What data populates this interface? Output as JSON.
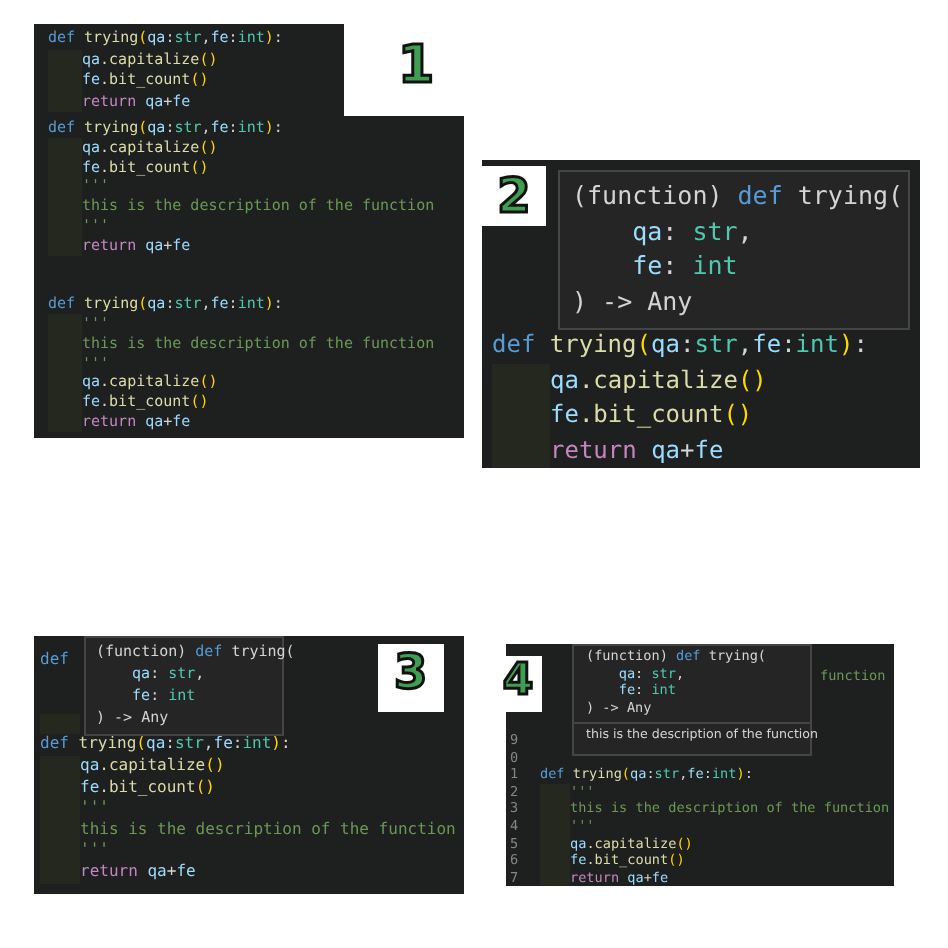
{
  "panels": [
    {
      "number": "1",
      "editors": [
        {
          "lines": [
            {
              "kind": "code",
              "indented": false,
              "tokens": [
                {
                  "kind": "keyword",
                  "text": "def"
                },
                {
                  "kind": "function",
                  "text": "trying",
                  "spaced": true
                },
                {
                  "kind": "bracket",
                  "text": "("
                },
                {
                  "kind": "param",
                  "text": "qa"
                },
                {
                  "kind": "plain",
                  "text": ":"
                },
                {
                  "kind": "type",
                  "text": "str"
                },
                {
                  "kind": "plain",
                  "text": ","
                },
                {
                  "kind": "param",
                  "text": "fe"
                },
                {
                  "kind": "plain",
                  "text": ":"
                },
                {
                  "kind": "type",
                  "text": "int"
                },
                {
                  "kind": "bracket",
                  "text": ")"
                },
                {
                  "kind": "plain",
                  "text": ":"
                }
              ]
            },
            {
              "kind": "code",
              "indented": true,
              "tokens": [
                {
                  "kind": "param",
                  "text": "qa"
                },
                {
                  "kind": "function",
                  "text": ".capitalize"
                },
                {
                  "kind": "bracket",
                  "text": "()"
                }
              ]
            },
            {
              "kind": "code",
              "indented": true,
              "tokens": [
                {
                  "kind": "param",
                  "text": "fe"
                },
                {
                  "kind": "function",
                  "text": ".bit_count"
                },
                {
                  "kind": "bracket",
                  "text": "()"
                }
              ]
            },
            {
              "kind": "code",
              "indented": true,
              "tokens": [
                {
                  "kind": "control",
                  "text": "return"
                },
                {
                  "kind": "param",
                  "text": "qa",
                  "spaced": true
                },
                {
                  "kind": "plain",
                  "text": "+"
                },
                {
                  "kind": "param",
                  "text": "fe"
                }
              ]
            }
          ]
        },
        {
          "lines": [
            {
              "kind": "code",
              "indented": false,
              "tokens": [
                {
                  "kind": "keyword",
                  "text": "def"
                },
                {
                  "kind": "function",
                  "text": "trying",
                  "spaced": true
                },
                {
                  "kind": "bracket",
                  "text": "("
                },
                {
                  "kind": "param",
                  "text": "qa"
                },
                {
                  "kind": "plain",
                  "text": ":"
                },
                {
                  "kind": "type",
                  "text": "str"
                },
                {
                  "kind": "plain",
                  "text": ","
                },
                {
                  "kind": "param",
                  "text": "fe"
                },
                {
                  "kind": "plain",
                  "text": ":"
                },
                {
                  "kind": "type",
                  "text": "int"
                },
                {
                  "kind": "bracket",
                  "text": ")"
                },
                {
                  "kind": "plain",
                  "text": ":"
                }
              ]
            },
            {
              "kind": "code",
              "indented": true,
              "tokens": [
                {
                  "kind": "param",
                  "text": "qa"
                },
                {
                  "kind": "function",
                  "text": ".capitalize"
                },
                {
                  "kind": "bracket",
                  "text": "()"
                }
              ]
            },
            {
              "kind": "code",
              "indented": true,
              "tokens": [
                {
                  "kind": "param",
                  "text": "fe"
                },
                {
                  "kind": "function",
                  "text": ".bit_count"
                },
                {
                  "kind": "bracket",
                  "text": "()"
                }
              ]
            },
            {
              "kind": "code",
              "indented": true,
              "tokens": [
                {
                  "kind": "comment",
                  "text": "'''"
                }
              ]
            },
            {
              "kind": "code",
              "indented": true,
              "tokens": [
                {
                  "kind": "comment",
                  "text": "this is the description of the function"
                }
              ]
            },
            {
              "kind": "code",
              "indented": true,
              "tokens": [
                {
                  "kind": "comment",
                  "text": "'''"
                }
              ]
            },
            {
              "kind": "code",
              "indented": true,
              "tokens": [
                {
                  "kind": "control",
                  "text": "return"
                },
                {
                  "kind": "param",
                  "text": "qa",
                  "spaced": true
                },
                {
                  "kind": "plain",
                  "text": "+"
                },
                {
                  "kind": "param",
                  "text": "fe"
                }
              ]
            },
            {
              "kind": "blank",
              "indented": false
            },
            {
              "kind": "blank",
              "indented": false
            },
            {
              "kind": "code",
              "indented": false,
              "tokens": [
                {
                  "kind": "keyword",
                  "text": "def"
                },
                {
                  "kind": "function",
                  "text": "trying",
                  "spaced": true
                },
                {
                  "kind": "bracket",
                  "text": "("
                },
                {
                  "kind": "param",
                  "text": "qa"
                },
                {
                  "kind": "plain",
                  "text": ":"
                },
                {
                  "kind": "type",
                  "text": "str"
                },
                {
                  "kind": "plain",
                  "text": ","
                },
                {
                  "kind": "param",
                  "text": "fe"
                },
                {
                  "kind": "plain",
                  "text": ":"
                },
                {
                  "kind": "type",
                  "text": "int"
                },
                {
                  "kind": "bracket",
                  "text": ")"
                },
                {
                  "kind": "plain",
                  "text": ":"
                }
              ]
            },
            {
              "kind": "code",
              "indented": true,
              "tokens": [
                {
                  "kind": "comment",
                  "text": "'''"
                }
              ]
            },
            {
              "kind": "code",
              "indented": true,
              "tokens": [
                {
                  "kind": "comment",
                  "text": "this is the description of the function"
                }
              ]
            },
            {
              "kind": "code",
              "indented": true,
              "tokens": [
                {
                  "kind": "comment",
                  "text": "'''"
                }
              ]
            },
            {
              "kind": "code",
              "indented": true,
              "tokens": [
                {
                  "kind": "param",
                  "text": "qa"
                },
                {
                  "kind": "function",
                  "text": ".capitalize"
                },
                {
                  "kind": "bracket",
                  "text": "()"
                }
              ]
            },
            {
              "kind": "code",
              "indented": true,
              "tokens": [
                {
                  "kind": "param",
                  "text": "fe"
                },
                {
                  "kind": "function",
                  "text": ".bit_count"
                },
                {
                  "kind": "bracket",
                  "text": "()"
                }
              ]
            },
            {
              "kind": "code",
              "indented": true,
              "tokens": [
                {
                  "kind": "control",
                  "text": "return"
                },
                {
                  "kind": "param",
                  "text": "qa",
                  "spaced": true
                },
                {
                  "kind": "plain",
                  "text": "+"
                },
                {
                  "kind": "param",
                  "text": "fe"
                }
              ]
            }
          ]
        }
      ]
    },
    {
      "number": "2",
      "tooltip": {
        "lines": [
          {
            "indented": false,
            "tokens": [
              {
                "kind": "plain",
                "text": "(function)"
              },
              {
                "kind": "keyword",
                "text": "def",
                "spaced": true
              },
              {
                "kind": "plain",
                "text": "trying(",
                "spaced": true
              }
            ]
          },
          {
            "indented": true,
            "tokens": [
              {
                "kind": "param",
                "text": "qa"
              },
              {
                "kind": "plain",
                "text": ":"
              },
              {
                "kind": "type",
                "text": "str",
                "spaced": true
              },
              {
                "kind": "plain",
                "text": ","
              }
            ]
          },
          {
            "indented": true,
            "tokens": [
              {
                "kind": "param",
                "text": "fe"
              },
              {
                "kind": "plain",
                "text": ":"
              },
              {
                "kind": "type",
                "text": "int",
                "spaced": true
              }
            ]
          },
          {
            "indented": false,
            "tokens": [
              {
                "kind": "plain",
                "text": ") -> Any"
              }
            ]
          }
        ]
      },
      "editors": [
        {
          "lines": [
            {
              "kind": "code",
              "indented": false,
              "tokens": [
                {
                  "kind": "keyword",
                  "text": "def"
                },
                {
                  "kind": "function",
                  "text": "trying",
                  "spaced": true
                },
                {
                  "kind": "bracket",
                  "text": "("
                },
                {
                  "kind": "param",
                  "text": "qa"
                },
                {
                  "kind": "plain",
                  "text": ":"
                },
                {
                  "kind": "type",
                  "text": "str"
                },
                {
                  "kind": "plain",
                  "text": ","
                },
                {
                  "kind": "param",
                  "text": "fe"
                },
                {
                  "kind": "plain",
                  "text": ":"
                },
                {
                  "kind": "type",
                  "text": "int"
                },
                {
                  "kind": "bracket",
                  "text": ")"
                },
                {
                  "kind": "plain",
                  "text": ":"
                }
              ]
            },
            {
              "kind": "code",
              "indented": true,
              "tokens": [
                {
                  "kind": "param",
                  "text": "qa"
                },
                {
                  "kind": "function",
                  "text": ".capitalize"
                },
                {
                  "kind": "bracket",
                  "text": "()"
                }
              ]
            },
            {
              "kind": "code",
              "indented": true,
              "tokens": [
                {
                  "kind": "param",
                  "text": "fe"
                },
                {
                  "kind": "function",
                  "text": ".bit_count"
                },
                {
                  "kind": "bracket",
                  "text": "()"
                }
              ]
            },
            {
              "kind": "code",
              "indented": true,
              "tokens": [
                {
                  "kind": "control",
                  "text": "return"
                },
                {
                  "kind": "param",
                  "text": "qa",
                  "spaced": true
                },
                {
                  "kind": "plain",
                  "text": "+"
                },
                {
                  "kind": "param",
                  "text": "fe"
                }
              ]
            }
          ]
        }
      ]
    },
    {
      "number": "3",
      "tooltip": {
        "lines": [
          {
            "indented": false,
            "tokens": [
              {
                "kind": "plain",
                "text": "(function)"
              },
              {
                "kind": "keyword",
                "text": "def",
                "spaced": true
              },
              {
                "kind": "plain",
                "text": "trying(",
                "spaced": true
              }
            ]
          },
          {
            "indented": true,
            "tokens": [
              {
                "kind": "param",
                "text": "qa"
              },
              {
                "kind": "plain",
                "text": ":"
              },
              {
                "kind": "type",
                "text": "str",
                "spaced": true
              },
              {
                "kind": "plain",
                "text": ","
              }
            ]
          },
          {
            "indented": true,
            "tokens": [
              {
                "kind": "param",
                "text": "fe"
              },
              {
                "kind": "plain",
                "text": ":"
              },
              {
                "kind": "type",
                "text": "int",
                "spaced": true
              }
            ]
          },
          {
            "indented": false,
            "tokens": [
              {
                "kind": "plain",
                "text": ") -> Any"
              }
            ]
          }
        ]
      },
      "editors": [
        {
          "lines": [
            {
              "kind": "code",
              "indented": false,
              "tokens": [
                {
                  "kind": "keyword",
                  "text": "def"
                }
              ]
            },
            {
              "kind": "blank",
              "indented": false
            },
            {
              "kind": "blank",
              "indented": false
            },
            {
              "kind": "blank",
              "indented": true
            },
            {
              "kind": "code",
              "indented": false,
              "tokens": [
                {
                  "kind": "keyword",
                  "text": "def"
                },
                {
                  "kind": "function",
                  "text": "trying",
                  "spaced": true
                },
                {
                  "kind": "bracket",
                  "text": "("
                },
                {
                  "kind": "param",
                  "text": "qa"
                },
                {
                  "kind": "plain",
                  "text": ":"
                },
                {
                  "kind": "type",
                  "text": "str"
                },
                {
                  "kind": "plain",
                  "text": ","
                },
                {
                  "kind": "param",
                  "text": "fe"
                },
                {
                  "kind": "plain",
                  "text": ":"
                },
                {
                  "kind": "type",
                  "text": "int"
                },
                {
                  "kind": "bracket",
                  "text": ")"
                },
                {
                  "kind": "plain",
                  "text": ":"
                }
              ]
            },
            {
              "kind": "code",
              "indented": true,
              "tokens": [
                {
                  "kind": "param",
                  "text": "qa"
                },
                {
                  "kind": "function",
                  "text": ".capitalize"
                },
                {
                  "kind": "bracket",
                  "text": "()"
                }
              ]
            },
            {
              "kind": "code",
              "indented": true,
              "tokens": [
                {
                  "kind": "param",
                  "text": "fe"
                },
                {
                  "kind": "function",
                  "text": ".bit_count"
                },
                {
                  "kind": "bracket",
                  "text": "()"
                }
              ]
            },
            {
              "kind": "code",
              "indented": true,
              "tokens": [
                {
                  "kind": "comment",
                  "text": "'''"
                }
              ]
            },
            {
              "kind": "code",
              "indented": true,
              "tokens": [
                {
                  "kind": "comment",
                  "text": "this is the description of the function"
                }
              ]
            },
            {
              "kind": "code",
              "indented": true,
              "tokens": [
                {
                  "kind": "comment",
                  "text": "'''"
                }
              ]
            },
            {
              "kind": "code",
              "indented": true,
              "tokens": [
                {
                  "kind": "control",
                  "text": "return"
                },
                {
                  "kind": "param",
                  "text": "qa",
                  "spaced": true
                },
                {
                  "kind": "plain",
                  "text": "+"
                },
                {
                  "kind": "param",
                  "text": "fe"
                }
              ]
            }
          ]
        }
      ]
    },
    {
      "number": "4",
      "tooltip": {
        "lines": [
          {
            "indented": false,
            "tokens": [
              {
                "kind": "plain",
                "text": "(function)"
              },
              {
                "kind": "keyword",
                "text": "def",
                "spaced": true
              },
              {
                "kind": "plain",
                "text": "trying(",
                "spaced": true
              }
            ]
          },
          {
            "indented": true,
            "tokens": [
              {
                "kind": "param",
                "text": "qa"
              },
              {
                "kind": "plain",
                "text": ":"
              },
              {
                "kind": "type",
                "text": "str",
                "spaced": true
              },
              {
                "kind": "plain",
                "text": ","
              }
            ]
          },
          {
            "indented": true,
            "tokens": [
              {
                "kind": "param",
                "text": "fe"
              },
              {
                "kind": "plain",
                "text": ":"
              },
              {
                "kind": "type",
                "text": "int",
                "spaced": true
              }
            ]
          },
          {
            "indented": false,
            "tokens": [
              {
                "kind": "plain",
                "text": ") -> Any"
              }
            ]
          }
        ],
        "doc": "this is the description of the function"
      },
      "partial_line": "function",
      "editors": [
        {
          "lines": [
            {
              "kind": "blank",
              "indented": false,
              "number": "9"
            },
            {
              "kind": "blank",
              "indented": false,
              "number": "0"
            },
            {
              "kind": "code",
              "indented": false,
              "number": "1",
              "tokens": [
                {
                  "kind": "keyword",
                  "text": "def"
                },
                {
                  "kind": "function",
                  "text": "trying",
                  "spaced": true
                },
                {
                  "kind": "bracket",
                  "text": "("
                },
                {
                  "kind": "param",
                  "text": "qa"
                },
                {
                  "kind": "plain",
                  "text": ":"
                },
                {
                  "kind": "type",
                  "text": "str"
                },
                {
                  "kind": "plain",
                  "text": ","
                },
                {
                  "kind": "param",
                  "text": "fe"
                },
                {
                  "kind": "plain",
                  "text": ":"
                },
                {
                  "kind": "type",
                  "text": "int"
                },
                {
                  "kind": "bracket",
                  "text": ")"
                },
                {
                  "kind": "plain",
                  "text": ":"
                }
              ]
            },
            {
              "kind": "code",
              "indented": true,
              "number": "2",
              "tokens": [
                {
                  "kind": "comment",
                  "text": "'''"
                }
              ]
            },
            {
              "kind": "code",
              "indented": true,
              "number": "3",
              "tokens": [
                {
                  "kind": "comment",
                  "text": "this is the description of the function"
                }
              ]
            },
            {
              "kind": "code",
              "indented": true,
              "number": "4",
              "tokens": [
                {
                  "kind": "comment",
                  "text": "'''"
                }
              ]
            },
            {
              "kind": "code",
              "indented": true,
              "number": "5",
              "tokens": [
                {
                  "kind": "param",
                  "text": "qa"
                },
                {
                  "kind": "function",
                  "text": ".capitalize"
                },
                {
                  "kind": "bracket",
                  "text": "()"
                }
              ]
            },
            {
              "kind": "code",
              "indented": true,
              "number": "6",
              "tokens": [
                {
                  "kind": "param",
                  "text": "fe"
                },
                {
                  "kind": "function",
                  "text": ".bit_count"
                },
                {
                  "kind": "bracket",
                  "text": "()"
                }
              ]
            },
            {
              "kind": "code",
              "indented": true,
              "number": "7",
              "tokens": [
                {
                  "kind": "control",
                  "text": "return"
                },
                {
                  "kind": "param",
                  "text": "qa",
                  "spaced": true
                },
                {
                  "kind": "plain",
                  "text": "+"
                },
                {
                  "kind": "param",
                  "text": "fe"
                }
              ]
            }
          ]
        }
      ]
    }
  ]
}
